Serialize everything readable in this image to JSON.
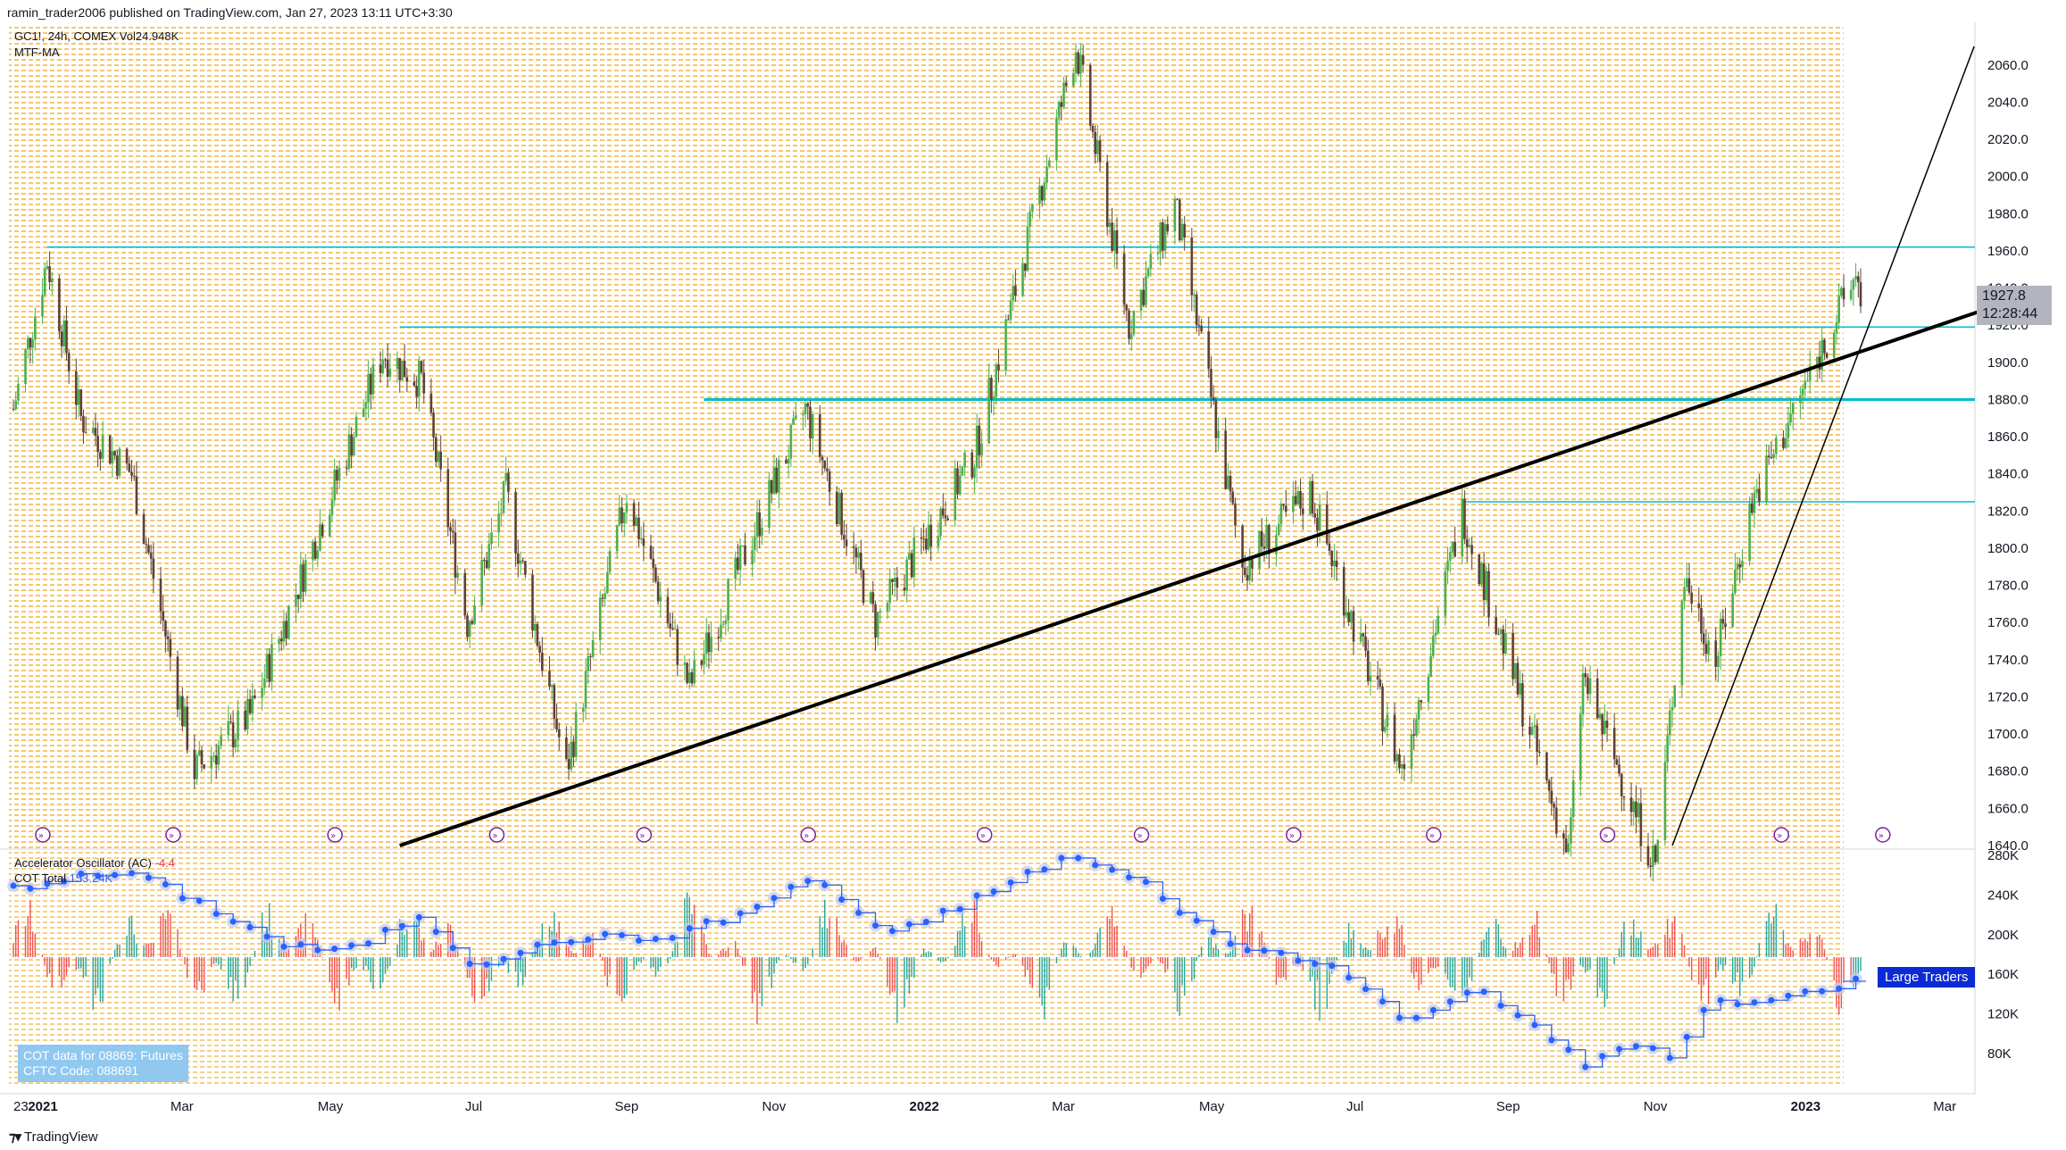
{
  "header": {
    "publish": "ramin_trader2006 published on TradingView.com, Jan 27, 2023 13:11 UTC+3:30",
    "symbol_line": "GC1!, 24h, COMEX  Vol24.948K",
    "study_line": "MTF-MA"
  },
  "lower_pane": {
    "ac_label": "Accelerator Oscillator (AC)",
    "ac_value": "-4.4",
    "cot_label": "COT Total",
    "cot_value": "153.24K",
    "cot_box_line1": "COT data for 08869: Futures",
    "cot_box_line2": "CFTC Code: 088691",
    "large_traders_label": "Large Traders"
  },
  "price_tag": {
    "price": "1927.8",
    "countdown": "12:28:44"
  },
  "footer": {
    "brand": "TradingView"
  },
  "colors": {
    "up_candle": "#26a69a",
    "up_candle_bright": "#4caf50",
    "down_candle": "#5d4037",
    "bg_stripes": "#f5b942",
    "support_line": "#00bcd4",
    "trendline": "#000000",
    "ac_up": "#26a69a",
    "ac_down": "#ef5350",
    "cot_line": "#2962ff"
  },
  "chart_data": [
    {
      "type": "candlestick",
      "symbol": "GC1!",
      "interval": "24h",
      "yaxis": {
        "ticks": [
          1640,
          1660,
          1680,
          1700,
          1720,
          1740,
          1760,
          1780,
          1800,
          1820,
          1840,
          1860,
          1880,
          1900,
          1920,
          1940,
          1960,
          1980,
          2000,
          2020,
          2040,
          2060
        ],
        "ylim": [
          1640,
          2070
        ]
      },
      "xaxis": {
        "ticks": [
          "23",
          "2021",
          "Mar",
          "May",
          "Jul",
          "Sep",
          "Nov",
          "2022",
          "Mar",
          "May",
          "Jul",
          "Sep",
          "Nov",
          "2023",
          "Mar"
        ]
      },
      "close_path": [
        {
          "date": "2020-12-23",
          "close": 1875
        },
        {
          "date": "2021-01-06",
          "close": 1955
        },
        {
          "date": "2021-01-20",
          "close": 1870
        },
        {
          "date": "2021-02-10",
          "close": 1840
        },
        {
          "date": "2021-03-08",
          "close": 1680
        },
        {
          "date": "2021-03-31",
          "close": 1710
        },
        {
          "date": "2021-04-20",
          "close": 1780
        },
        {
          "date": "2021-05-25",
          "close": 1905
        },
        {
          "date": "2021-06-10",
          "close": 1890
        },
        {
          "date": "2021-06-29",
          "close": 1760
        },
        {
          "date": "2021-07-15",
          "close": 1830
        },
        {
          "date": "2021-08-09",
          "close": 1680
        },
        {
          "date": "2021-09-03",
          "close": 1830
        },
        {
          "date": "2021-09-29",
          "close": 1725
        },
        {
          "date": "2021-11-16",
          "close": 1875
        },
        {
          "date": "2021-12-15",
          "close": 1760
        },
        {
          "date": "2022-01-25",
          "close": 1850
        },
        {
          "date": "2022-03-08",
          "close": 2070
        },
        {
          "date": "2022-03-30",
          "close": 1920
        },
        {
          "date": "2022-04-18",
          "close": 1985
        },
        {
          "date": "2022-05-16",
          "close": 1790
        },
        {
          "date": "2022-06-13",
          "close": 1830
        },
        {
          "date": "2022-07-21",
          "close": 1680
        },
        {
          "date": "2022-08-15",
          "close": 1820
        },
        {
          "date": "2022-09-28",
          "close": 1635
        },
        {
          "date": "2022-10-04",
          "close": 1730
        },
        {
          "date": "2022-11-03",
          "close": 1630
        },
        {
          "date": "2022-11-15",
          "close": 1785
        },
        {
          "date": "2022-11-28",
          "close": 1740
        },
        {
          "date": "2022-12-13",
          "close": 1825
        },
        {
          "date": "2023-01-26",
          "close": 1950
        },
        {
          "date": "2023-01-27",
          "close": 1928
        }
      ],
      "horizontal_levels": [
        {
          "price": 1962,
          "from": "2021-01-06"
        },
        {
          "price": 1919,
          "from": "2021-06-01"
        },
        {
          "price": 1880,
          "from": "2021-10-05",
          "style": "thick"
        },
        {
          "price": 1825,
          "from": "2022-08-15"
        }
      ],
      "trendlines": [
        {
          "from": {
            "date": "2021-06-01",
            "price": 1640
          },
          "to": {
            "date": "2023-03-30",
            "price": 1933
          },
          "style": "thick"
        },
        {
          "from": {
            "date": "2022-11-10",
            "price": 1640
          },
          "to": {
            "date": "2023-03-15",
            "price": 2070
          }
        }
      ],
      "last_price": 1927.8
    },
    {
      "type": "bar",
      "name": "Accelerator Oscillator (AC)",
      "last_value": -4.4,
      "note": "bars oscillate around zero in the lower pane"
    },
    {
      "type": "line",
      "name": "COT Total",
      "yaxis": {
        "ticks": [
          "280K",
          "240K",
          "200K",
          "160K",
          "120K",
          "80K"
        ],
        "ylim": [
          60,
          290
        ]
      },
      "points_k": [
        {
          "date": "2020-12-23",
          "value": 247
        },
        {
          "date": "2021-01-15",
          "value": 257
        },
        {
          "date": "2021-02-10",
          "value": 262
        },
        {
          "date": "2021-03-10",
          "value": 232
        },
        {
          "date": "2021-04-15",
          "value": 188
        },
        {
          "date": "2021-05-10",
          "value": 183
        },
        {
          "date": "2021-06-10",
          "value": 220
        },
        {
          "date": "2021-07-01",
          "value": 170
        },
        {
          "date": "2021-08-15",
          "value": 198
        },
        {
          "date": "2021-09-15",
          "value": 195
        },
        {
          "date": "2021-10-20",
          "value": 220
        },
        {
          "date": "2021-11-20",
          "value": 258
        },
        {
          "date": "2021-12-20",
          "value": 198
        },
        {
          "date": "2022-01-25",
          "value": 235
        },
        {
          "date": "2022-03-05",
          "value": 280
        },
        {
          "date": "2022-04-05",
          "value": 252
        },
        {
          "date": "2022-05-10",
          "value": 190
        },
        {
          "date": "2022-06-20",
          "value": 172
        },
        {
          "date": "2022-07-25",
          "value": 110
        },
        {
          "date": "2022-08-20",
          "value": 150
        },
        {
          "date": "2022-09-20",
          "value": 95
        },
        {
          "date": "2022-10-05",
          "value": 68
        },
        {
          "date": "2022-10-25",
          "value": 92
        },
        {
          "date": "2022-11-10",
          "value": 73
        },
        {
          "date": "2022-11-25",
          "value": 130
        },
        {
          "date": "2022-12-20",
          "value": 132
        },
        {
          "date": "2023-01-25",
          "value": 153
        }
      ]
    }
  ]
}
